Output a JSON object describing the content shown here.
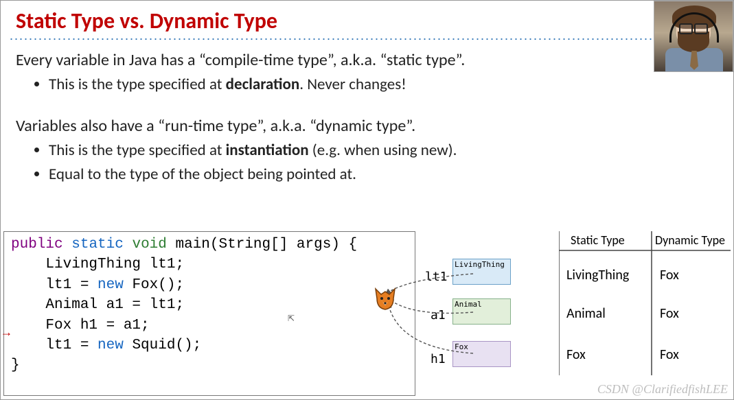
{
  "title": "Static Type vs. Dynamic Type",
  "para1": "Every variable in Java has a “compile-time type”, a.k.a. “static type”.",
  "bullets1": {
    "b0_pre": "This is the type specified at ",
    "b0_bold": "declaration",
    "b0_post": ". Never changes!"
  },
  "para2": "Variables also have a “run-time type”, a.k.a. “dynamic type”.",
  "bullets2": {
    "b0_pre": "This is the type specified at ",
    "b0_bold": "instantiation",
    "b0_post": " (e.g. when using new).",
    "b1": "Equal to the type of the object being pointed at."
  },
  "code": {
    "kw_public": "public",
    "kw_static": "static",
    "kw_void": "void",
    "sig_rest": " main(String[] args) {",
    "l2": "    LivingThing lt1;",
    "l3_pre": "    lt1 = ",
    "kw_new": "new",
    "l3_post": " Fox();",
    "l4": "    Animal a1 = lt1;",
    "l5": "    Fox h1 = a1;",
    "l6_pre": "    lt1 = ",
    "l6_post": " Squid();",
    "l7": "}",
    "arrow": "→"
  },
  "diagram": {
    "headers": {
      "static": "Static Type",
      "dynamic": "Dynamic Type"
    },
    "vars": {
      "lt1": "lt1",
      "a1": "a1",
      "h1": "h1"
    },
    "boxes": {
      "lt": "LivingThing",
      "an": "Animal",
      "fx": "Fox"
    },
    "rows": [
      {
        "s": "LivingThing",
        "d": "Fox"
      },
      {
        "s": "Animal",
        "d": "Fox"
      },
      {
        "s": "Fox",
        "d": "Fox"
      }
    ],
    "fox_icon": "fox-icon"
  },
  "cursor_glyph": "⇱",
  "watermark": "CSDN @ClarifiedfishLEE"
}
